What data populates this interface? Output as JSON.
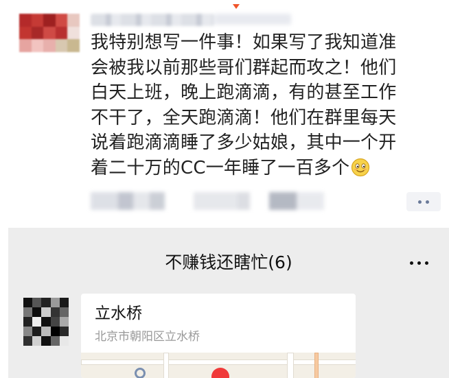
{
  "post": {
    "text": "我特别想写一件事！如果写了我知道准\n会被我以前那些哥们群起而攻之！他们\n白天上班，晚上跑滴滴，有的甚至工作\n不干了，全天跑滴滴！他们在群里每天\n说着跑滴滴睡了多少姑娘，其中一个开\n着二十万的CC一年睡了一百多个",
    "emoji_icon": "smiley-emoji-icon",
    "more_icon": "more-dots-icon"
  },
  "chat": {
    "title": "不赚钱还瞎忙(6)",
    "more_icon": "more-dots-icon",
    "location": {
      "name": "立水桥",
      "address": "北京市朝阳区立水桥"
    },
    "map_pin_color": "#f03a3a"
  },
  "colors": {
    "accent_arrow": "#f0552c",
    "chat_background": "#ededed"
  }
}
